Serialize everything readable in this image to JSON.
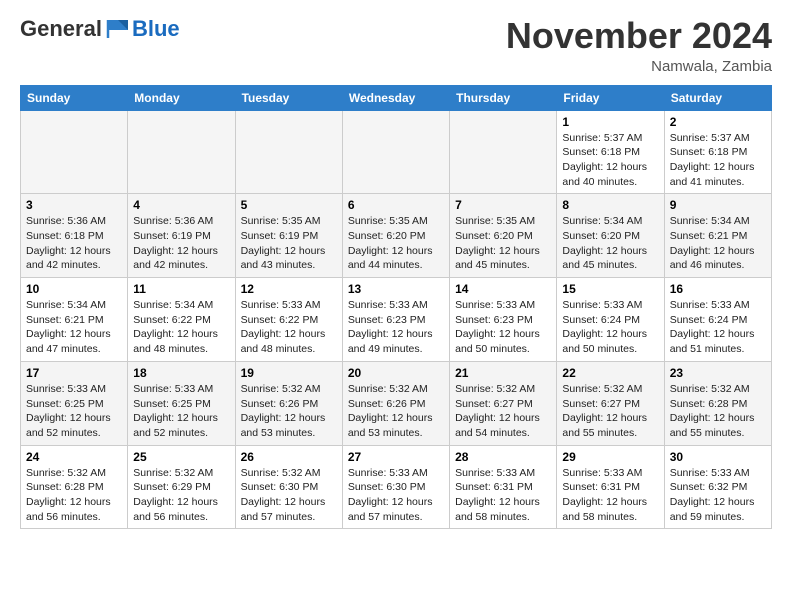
{
  "logo": {
    "general": "General",
    "blue": "Blue"
  },
  "title": "November 2024",
  "location": "Namwala, Zambia",
  "weekdays": [
    "Sunday",
    "Monday",
    "Tuesday",
    "Wednesday",
    "Thursday",
    "Friday",
    "Saturday"
  ],
  "weeks": [
    [
      {
        "day": "",
        "info": ""
      },
      {
        "day": "",
        "info": ""
      },
      {
        "day": "",
        "info": ""
      },
      {
        "day": "",
        "info": ""
      },
      {
        "day": "",
        "info": ""
      },
      {
        "day": "1",
        "info": "Sunrise: 5:37 AM\nSunset: 6:18 PM\nDaylight: 12 hours\nand 40 minutes."
      },
      {
        "day": "2",
        "info": "Sunrise: 5:37 AM\nSunset: 6:18 PM\nDaylight: 12 hours\nand 41 minutes."
      }
    ],
    [
      {
        "day": "3",
        "info": "Sunrise: 5:36 AM\nSunset: 6:18 PM\nDaylight: 12 hours\nand 42 minutes."
      },
      {
        "day": "4",
        "info": "Sunrise: 5:36 AM\nSunset: 6:19 PM\nDaylight: 12 hours\nand 42 minutes."
      },
      {
        "day": "5",
        "info": "Sunrise: 5:35 AM\nSunset: 6:19 PM\nDaylight: 12 hours\nand 43 minutes."
      },
      {
        "day": "6",
        "info": "Sunrise: 5:35 AM\nSunset: 6:20 PM\nDaylight: 12 hours\nand 44 minutes."
      },
      {
        "day": "7",
        "info": "Sunrise: 5:35 AM\nSunset: 6:20 PM\nDaylight: 12 hours\nand 45 minutes."
      },
      {
        "day": "8",
        "info": "Sunrise: 5:34 AM\nSunset: 6:20 PM\nDaylight: 12 hours\nand 45 minutes."
      },
      {
        "day": "9",
        "info": "Sunrise: 5:34 AM\nSunset: 6:21 PM\nDaylight: 12 hours\nand 46 minutes."
      }
    ],
    [
      {
        "day": "10",
        "info": "Sunrise: 5:34 AM\nSunset: 6:21 PM\nDaylight: 12 hours\nand 47 minutes."
      },
      {
        "day": "11",
        "info": "Sunrise: 5:34 AM\nSunset: 6:22 PM\nDaylight: 12 hours\nand 48 minutes."
      },
      {
        "day": "12",
        "info": "Sunrise: 5:33 AM\nSunset: 6:22 PM\nDaylight: 12 hours\nand 48 minutes."
      },
      {
        "day": "13",
        "info": "Sunrise: 5:33 AM\nSunset: 6:23 PM\nDaylight: 12 hours\nand 49 minutes."
      },
      {
        "day": "14",
        "info": "Sunrise: 5:33 AM\nSunset: 6:23 PM\nDaylight: 12 hours\nand 50 minutes."
      },
      {
        "day": "15",
        "info": "Sunrise: 5:33 AM\nSunset: 6:24 PM\nDaylight: 12 hours\nand 50 minutes."
      },
      {
        "day": "16",
        "info": "Sunrise: 5:33 AM\nSunset: 6:24 PM\nDaylight: 12 hours\nand 51 minutes."
      }
    ],
    [
      {
        "day": "17",
        "info": "Sunrise: 5:33 AM\nSunset: 6:25 PM\nDaylight: 12 hours\nand 52 minutes."
      },
      {
        "day": "18",
        "info": "Sunrise: 5:33 AM\nSunset: 6:25 PM\nDaylight: 12 hours\nand 52 minutes."
      },
      {
        "day": "19",
        "info": "Sunrise: 5:32 AM\nSunset: 6:26 PM\nDaylight: 12 hours\nand 53 minutes."
      },
      {
        "day": "20",
        "info": "Sunrise: 5:32 AM\nSunset: 6:26 PM\nDaylight: 12 hours\nand 53 minutes."
      },
      {
        "day": "21",
        "info": "Sunrise: 5:32 AM\nSunset: 6:27 PM\nDaylight: 12 hours\nand 54 minutes."
      },
      {
        "day": "22",
        "info": "Sunrise: 5:32 AM\nSunset: 6:27 PM\nDaylight: 12 hours\nand 55 minutes."
      },
      {
        "day": "23",
        "info": "Sunrise: 5:32 AM\nSunset: 6:28 PM\nDaylight: 12 hours\nand 55 minutes."
      }
    ],
    [
      {
        "day": "24",
        "info": "Sunrise: 5:32 AM\nSunset: 6:28 PM\nDaylight: 12 hours\nand 56 minutes."
      },
      {
        "day": "25",
        "info": "Sunrise: 5:32 AM\nSunset: 6:29 PM\nDaylight: 12 hours\nand 56 minutes."
      },
      {
        "day": "26",
        "info": "Sunrise: 5:32 AM\nSunset: 6:30 PM\nDaylight: 12 hours\nand 57 minutes."
      },
      {
        "day": "27",
        "info": "Sunrise: 5:33 AM\nSunset: 6:30 PM\nDaylight: 12 hours\nand 57 minutes."
      },
      {
        "day": "28",
        "info": "Sunrise: 5:33 AM\nSunset: 6:31 PM\nDaylight: 12 hours\nand 58 minutes."
      },
      {
        "day": "29",
        "info": "Sunrise: 5:33 AM\nSunset: 6:31 PM\nDaylight: 12 hours\nand 58 minutes."
      },
      {
        "day": "30",
        "info": "Sunrise: 5:33 AM\nSunset: 6:32 PM\nDaylight: 12 hours\nand 59 minutes."
      }
    ]
  ]
}
